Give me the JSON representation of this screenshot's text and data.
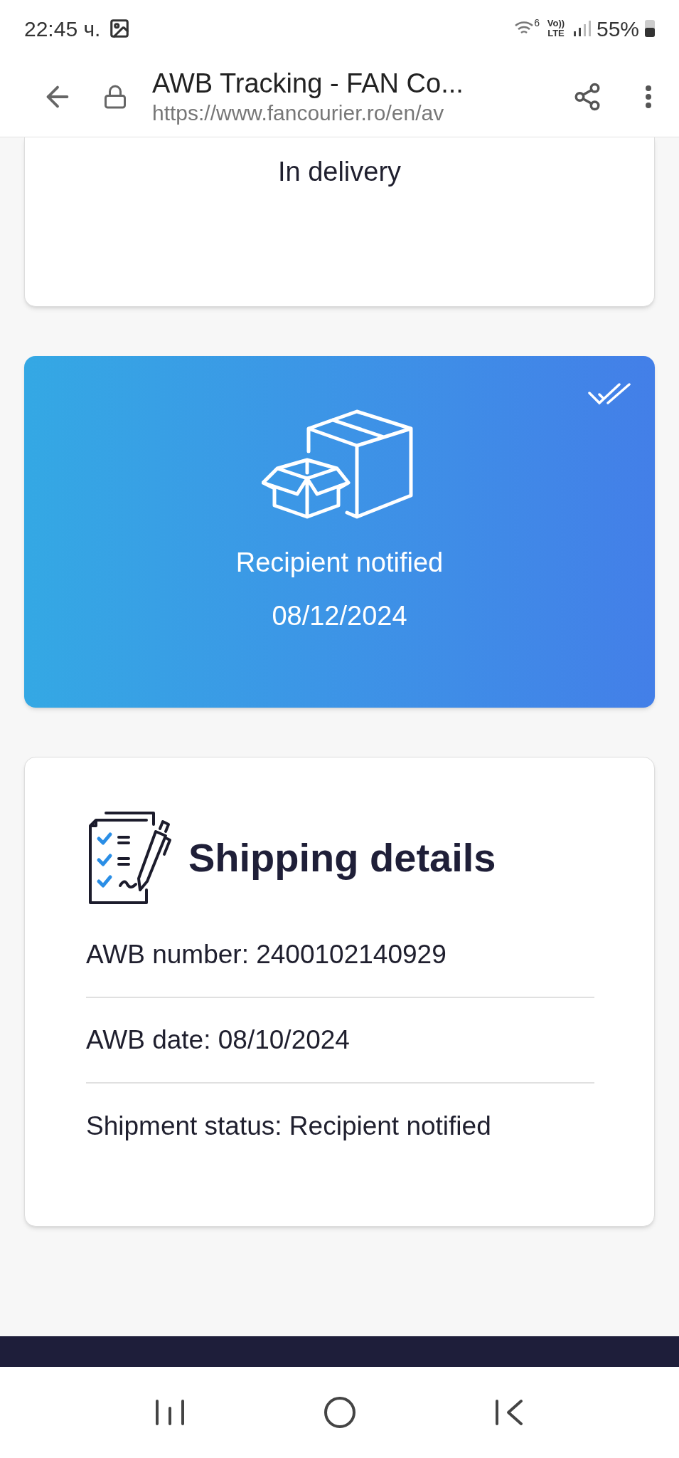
{
  "status_bar": {
    "time": "22:45 ч.",
    "network_badge": "6",
    "volte": "Vo)) LTE",
    "battery": "55%"
  },
  "browser": {
    "title": "AWB Tracking - FAN Co...",
    "url": "https://www.fancourier.ro/en/av"
  },
  "previous_card": {
    "label": "In delivery"
  },
  "status_card": {
    "label": "Recipient notified",
    "date": "08/12/2024"
  },
  "details_card": {
    "title": "Shipping details",
    "rows": [
      {
        "text": "AWB number: 2400102140929"
      },
      {
        "text": "AWB date: 08/10/2024"
      },
      {
        "text": "Shipment status: Recipient notified"
      }
    ]
  }
}
